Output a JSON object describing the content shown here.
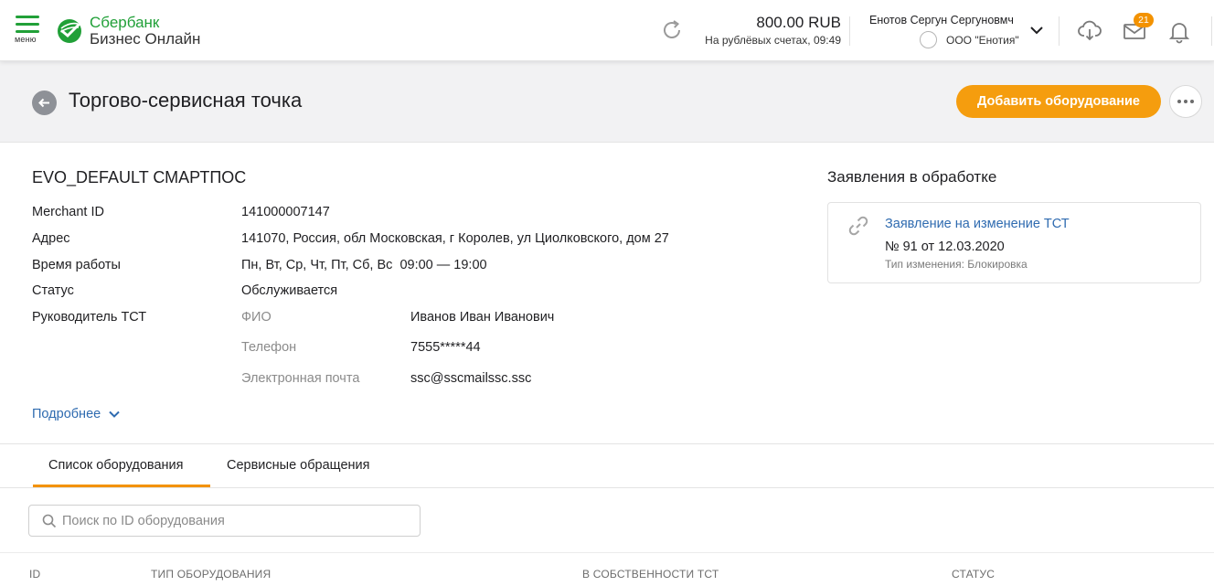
{
  "header": {
    "menu_label": "меню",
    "logo_line1": "Сбербанк",
    "logo_line2": "Бизнес Онлайн",
    "balance_amount": "800.00 RUB",
    "balance_note": "На рублёвых счетах, 09:49",
    "user_name": "Енотов Сергун Сергуновмч",
    "org_name": "ООО \"Енотия\"",
    "messages_badge": "21",
    "icons": [
      "refresh-icon",
      "chevron-down-icon",
      "cloud-download-icon",
      "envelope-icon",
      "bell-icon"
    ]
  },
  "page": {
    "title": "Торгово-сервисная точка",
    "add_button": "Добавить оборудование"
  },
  "device": {
    "name": "EVO_DEFAULT СМАРТПОС",
    "fields": [
      {
        "label": "Merchant ID",
        "value": "141000007147"
      },
      {
        "label": "Адрес",
        "value": "141070, Россия, обл Московская, г Королев, ул Циолковского, дом 27"
      },
      {
        "label": "Время работы",
        "value": "Пн, Вт, Ср, Чт, Пт, Сб, Вс  09:00 — 19:00"
      },
      {
        "label": "Статус",
        "value": "Обслуживается"
      }
    ],
    "manager_label": "Руководитель ТСТ",
    "manager": [
      {
        "label": "ФИО",
        "value": "Иванов Иван Иванович"
      },
      {
        "label": "Телефон",
        "value": "7555*****44"
      },
      {
        "label": "Электронная почта",
        "value": "ssc@sscmailssc.ssc"
      }
    ],
    "more_link": "Подробнее"
  },
  "requests": {
    "title": "Заявления в обработке",
    "item": {
      "link": "Заявление на изменение ТСТ",
      "number": "№ 91 от 12.03.2020",
      "type": "Тип изменения: Блокировка"
    }
  },
  "tabs": [
    {
      "label": "Список оборудования",
      "active": true
    },
    {
      "label": "Сервисные обращения",
      "active": false
    }
  ],
  "search": {
    "placeholder": "Поиск по ID оборудования",
    "value": ""
  },
  "table": {
    "columns": [
      "ID",
      "ТИП ОБОРУДОВАНИЯ",
      "В СОБСТВЕННОСТИ ТСТ",
      "СТАТУС"
    ]
  },
  "colors": {
    "brand_green": "#21a038",
    "accent_orange": "#f59d0e",
    "link_blue": "#2f6bb0"
  }
}
